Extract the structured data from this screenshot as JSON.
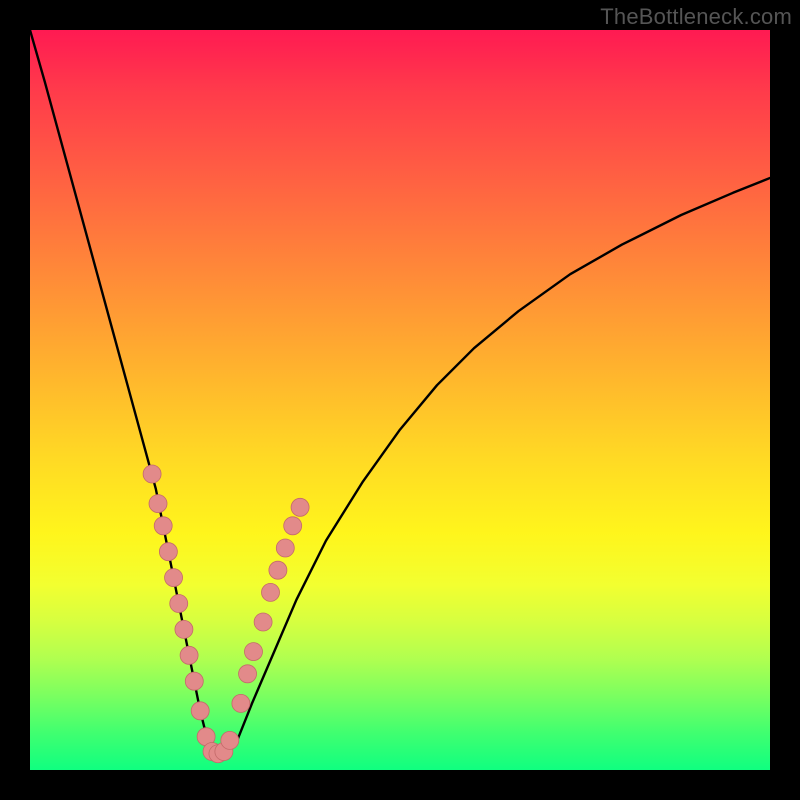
{
  "watermark": "TheBottleneck.com",
  "colors": {
    "curve_stroke": "#000000",
    "marker_fill": "#e28a8a",
    "marker_stroke": "#c46a6a",
    "frame_bg": "#000000"
  },
  "chart_data": {
    "type": "line",
    "title": "",
    "xlabel": "",
    "ylabel": "",
    "xlim": [
      0,
      100
    ],
    "ylim": [
      0,
      100
    ],
    "grid": false,
    "legend": false,
    "series": [
      {
        "name": "bottleneck-curve",
        "x": [
          0,
          2,
          5,
          8,
          11,
          14,
          17,
          18,
          19,
          20,
          21,
          22,
          23,
          24,
          25,
          26,
          28,
          30,
          33,
          36,
          40,
          45,
          50,
          55,
          60,
          66,
          73,
          80,
          88,
          95,
          100
        ],
        "y": [
          100,
          93,
          82,
          71,
          60,
          49,
          38,
          33,
          28,
          23,
          18,
          13,
          8,
          4,
          2,
          2,
          4,
          9,
          16,
          23,
          31,
          39,
          46,
          52,
          57,
          62,
          67,
          71,
          75,
          78,
          80
        ]
      }
    ],
    "markers": {
      "name": "highlighted-points",
      "comment": "coral dots clustered near the V-curve floor",
      "points": [
        {
          "x": 16.5,
          "y": 40
        },
        {
          "x": 17.3,
          "y": 36
        },
        {
          "x": 18.0,
          "y": 33
        },
        {
          "x": 18.7,
          "y": 29.5
        },
        {
          "x": 19.4,
          "y": 26
        },
        {
          "x": 20.1,
          "y": 22.5
        },
        {
          "x": 20.8,
          "y": 19
        },
        {
          "x": 21.5,
          "y": 15.5
        },
        {
          "x": 22.2,
          "y": 12
        },
        {
          "x": 23.0,
          "y": 8
        },
        {
          "x": 23.8,
          "y": 4.5
        },
        {
          "x": 24.6,
          "y": 2.5
        },
        {
          "x": 25.4,
          "y": 2.2
        },
        {
          "x": 26.2,
          "y": 2.5
        },
        {
          "x": 27.0,
          "y": 4
        },
        {
          "x": 28.5,
          "y": 9
        },
        {
          "x": 29.4,
          "y": 13
        },
        {
          "x": 30.2,
          "y": 16
        },
        {
          "x": 31.5,
          "y": 20
        },
        {
          "x": 32.5,
          "y": 24
        },
        {
          "x": 33.5,
          "y": 27
        },
        {
          "x": 34.5,
          "y": 30
        },
        {
          "x": 35.5,
          "y": 33
        },
        {
          "x": 36.5,
          "y": 35.5
        }
      ]
    }
  }
}
